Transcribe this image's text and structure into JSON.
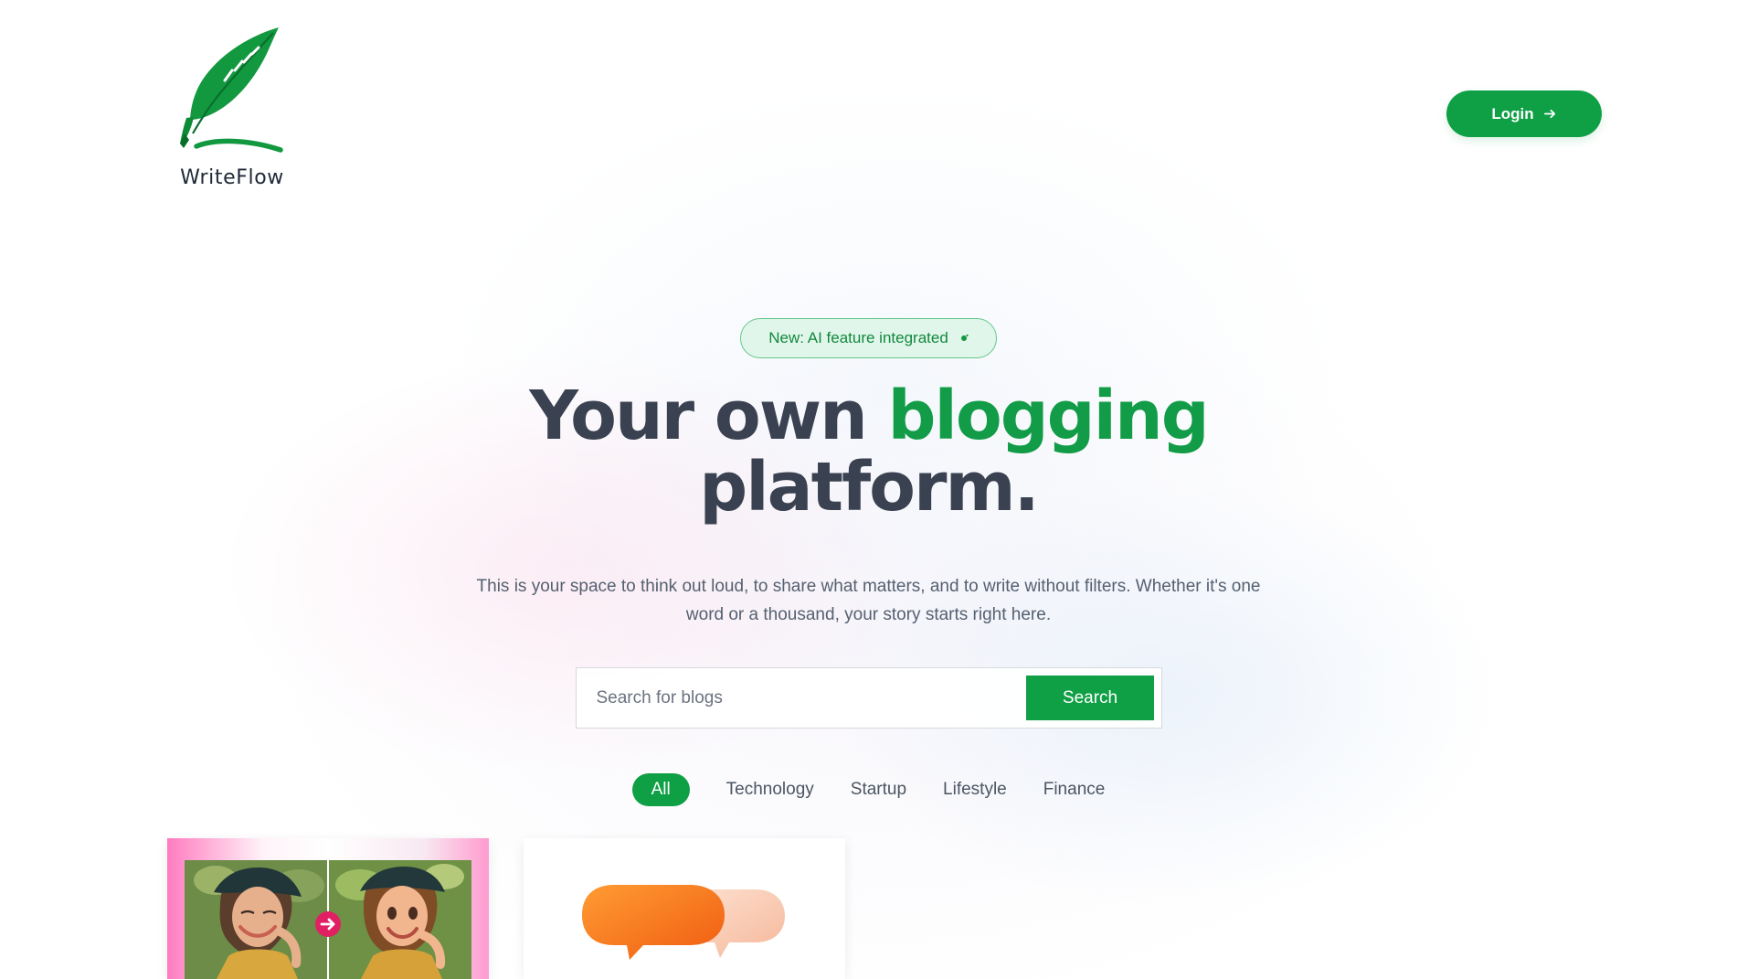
{
  "brand": {
    "name": "WriteFlow",
    "logo_icon": "feather-pen-icon",
    "accent_color": "#129c47"
  },
  "header": {
    "login_label": "Login",
    "login_icon": "arrow-right-icon"
  },
  "hero": {
    "announcement": "New: AI feature integrated",
    "announcement_icon": "sparkle-icon",
    "title_before": "Your own",
    "title_accent": "blogging",
    "title_after": "platform.",
    "subtitle": "This is your space to think out loud, to share what matters, and to write without filters. Whether it's one word or a thousand, your story starts right here."
  },
  "search": {
    "placeholder": "Search for blogs",
    "value": "",
    "button_label": "Search"
  },
  "categories": [
    {
      "label": "All",
      "active": true
    },
    {
      "label": "Technology",
      "active": false
    },
    {
      "label": "Startup",
      "active": false
    },
    {
      "label": "Lifestyle",
      "active": false
    },
    {
      "label": "Finance",
      "active": false
    }
  ],
  "cards": [
    {
      "image_type": "photo-to-cartoon",
      "icon": "arrow-right-icon"
    },
    {
      "image_type": "chat-bubbles-icon"
    }
  ],
  "colors": {
    "primary_green": "#0f9f45",
    "text_dark": "#3a4150",
    "text_muted": "#556070",
    "announcement_bg": "#def5e8"
  }
}
